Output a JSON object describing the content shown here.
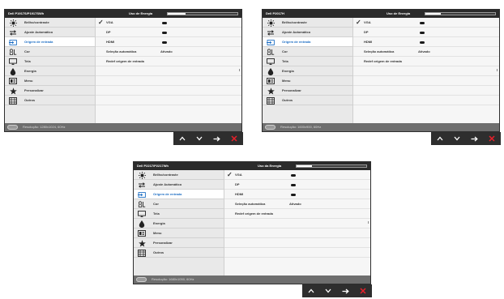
{
  "osds": [
    {
      "model": "Dell P1917S/P1917SWh",
      "energy_title": "Uso de Energia",
      "energy_level_percent": 25,
      "menu": [
        {
          "icon": "brightness-icon",
          "label": "Brilho/contraste"
        },
        {
          "icon": "auto-adjust-icon",
          "label": "Ajuste Automático"
        },
        {
          "icon": "input-source-icon",
          "label": "Origem de entrada"
        },
        {
          "icon": "color-icon",
          "label": "Cor"
        },
        {
          "icon": "display-icon",
          "label": "Tela"
        },
        {
          "icon": "energy-icon",
          "label": "Energia"
        },
        {
          "icon": "menu-icon",
          "label": "Menu"
        },
        {
          "icon": "personalize-icon",
          "label": "Personalizar"
        },
        {
          "icon": "other-icon",
          "label": "Outros"
        }
      ],
      "selected_menu_index": 2,
      "sources": [
        {
          "label": "VGA",
          "checked": true
        },
        {
          "label": "DP",
          "checked": false
        },
        {
          "label": "HDMI",
          "checked": false
        }
      ],
      "auto_select": {
        "label": "Seleção automática",
        "value": "Ativado"
      },
      "reset_label": "Redef origem de entrada",
      "resolution": "Resolução: 1280x1024, 60Hz",
      "check_mark": "✓",
      "nav": {
        "up": "∧",
        "down": "∨",
        "enter": "→",
        "exit": "✕"
      }
    },
    {
      "model": "Dell P2017H",
      "energy_title": "Uso de Energia",
      "energy_level_percent": 22,
      "menu": [
        {
          "icon": "brightness-icon",
          "label": "Brilho/contraste"
        },
        {
          "icon": "auto-adjust-icon",
          "label": "Ajuste Automático"
        },
        {
          "icon": "input-source-icon",
          "label": "Origem de entrada"
        },
        {
          "icon": "color-icon",
          "label": "Cor"
        },
        {
          "icon": "display-icon",
          "label": "Tela"
        },
        {
          "icon": "energy-icon",
          "label": "Energia"
        },
        {
          "icon": "menu-icon",
          "label": "Menu"
        },
        {
          "icon": "personalize-icon",
          "label": "Personalizar"
        },
        {
          "icon": "other-icon",
          "label": "Outros"
        }
      ],
      "selected_menu_index": 2,
      "sources": [
        {
          "label": "VGA",
          "checked": true
        },
        {
          "label": "DP",
          "checked": false
        },
        {
          "label": "HDMI",
          "checked": false
        }
      ],
      "auto_select": {
        "label": "Seleção automática",
        "value": "Ativado"
      },
      "reset_label": "Redef origem de entrada",
      "resolution": "Resolução: 1600x900, 60Hz",
      "check_mark": "✓",
      "nav": {
        "up": "∧",
        "down": "∨",
        "enter": "→",
        "exit": "✕"
      }
    },
    {
      "model": "Dell P2217/P2217Wh",
      "energy_title": "Uso da Energia",
      "energy_level_percent": 22,
      "menu": [
        {
          "icon": "brightness-icon",
          "label": "Brilho/contraste"
        },
        {
          "icon": "auto-adjust-icon",
          "label": "Ajuste Automático"
        },
        {
          "icon": "input-source-icon",
          "label": "Origem de entrada"
        },
        {
          "icon": "color-icon",
          "label": "Cor"
        },
        {
          "icon": "display-icon",
          "label": "Tela"
        },
        {
          "icon": "energy-icon",
          "label": "Energia"
        },
        {
          "icon": "menu-icon",
          "label": "Menu"
        },
        {
          "icon": "personalize-icon",
          "label": "Personalizar"
        },
        {
          "icon": "other-icon",
          "label": "Outros"
        }
      ],
      "selected_menu_index": 2,
      "sources": [
        {
          "label": "VGA",
          "checked": true
        },
        {
          "label": "DP",
          "checked": false
        },
        {
          "label": "HDMI",
          "checked": false
        }
      ],
      "auto_select": {
        "label": "Seleção automática",
        "value": "Ativado"
      },
      "reset_label": "Redef origem de entrada",
      "resolution": "Resolução: 1680x1050, 60Hz",
      "check_mark": "✓",
      "nav": {
        "up": "∧",
        "down": "∨",
        "enter": "→",
        "exit": "✕"
      }
    }
  ],
  "colors": {
    "header_bg": "#2b2b2b",
    "selected_text": "#1f6fc4",
    "footer_bg": "#6e6e6e",
    "exit_red": "#e8202a",
    "nav_bg": "#2e2e2e"
  }
}
